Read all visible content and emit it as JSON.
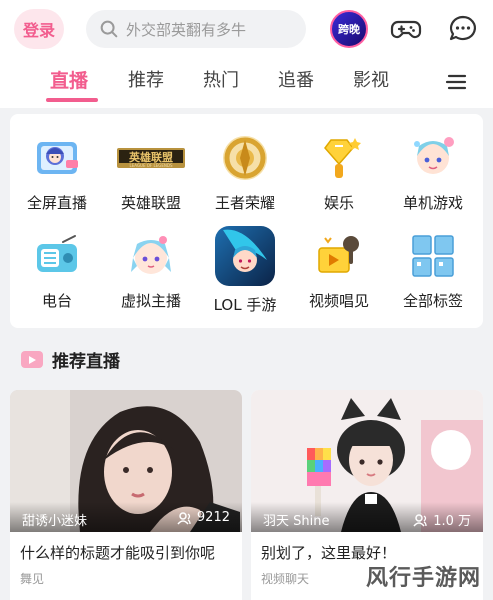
{
  "header": {
    "login_label": "登录",
    "search_placeholder": "外交部英翻有多牛",
    "crossover_badge": "跨晚",
    "icons": [
      "search-icon",
      "gamepad-icon",
      "message-icon"
    ]
  },
  "tabs": [
    {
      "label": "直播",
      "active": true
    },
    {
      "label": "推荐",
      "active": false
    },
    {
      "label": "热门",
      "active": false
    },
    {
      "label": "追番",
      "active": false
    },
    {
      "label": "影视",
      "active": false
    }
  ],
  "categories": [
    {
      "label": "全屏直播",
      "icon": "fullscreen-live-icon"
    },
    {
      "label": "英雄联盟",
      "icon": "lol-logo-icon",
      "logo_text": "英雄联盟",
      "logo_sub": "LEAGUE OF LEGENDS"
    },
    {
      "label": "王者荣耀",
      "icon": "honor-of-kings-icon"
    },
    {
      "label": "娱乐",
      "icon": "entertainment-icon"
    },
    {
      "label": "单机游戏",
      "icon": "single-player-game-icon"
    },
    {
      "label": "电台",
      "icon": "radio-icon"
    },
    {
      "label": "虚拟主播",
      "icon": "virtual-streamer-icon"
    },
    {
      "label": "LOL 手游",
      "icon": "lol-mobile-icon"
    },
    {
      "label": "视频唱见",
      "icon": "video-singer-icon"
    },
    {
      "label": "全部标签",
      "icon": "all-tags-icon"
    }
  ],
  "recommend": {
    "title": "推荐直播",
    "cards": [
      {
        "uname": "甜诱小迷妹",
        "viewers": "9212",
        "title": "什么样的标题才能吸引到你呢",
        "tag": "舞见"
      },
      {
        "uname": "羽天 Shine",
        "viewers": "1.0 万",
        "title": "别划了，这里最好！",
        "tag": "视频聊天"
      }
    ]
  },
  "watermark": "风行手游网",
  "colors": {
    "accent": "#f25d8e",
    "background": "#f1f2f4"
  }
}
